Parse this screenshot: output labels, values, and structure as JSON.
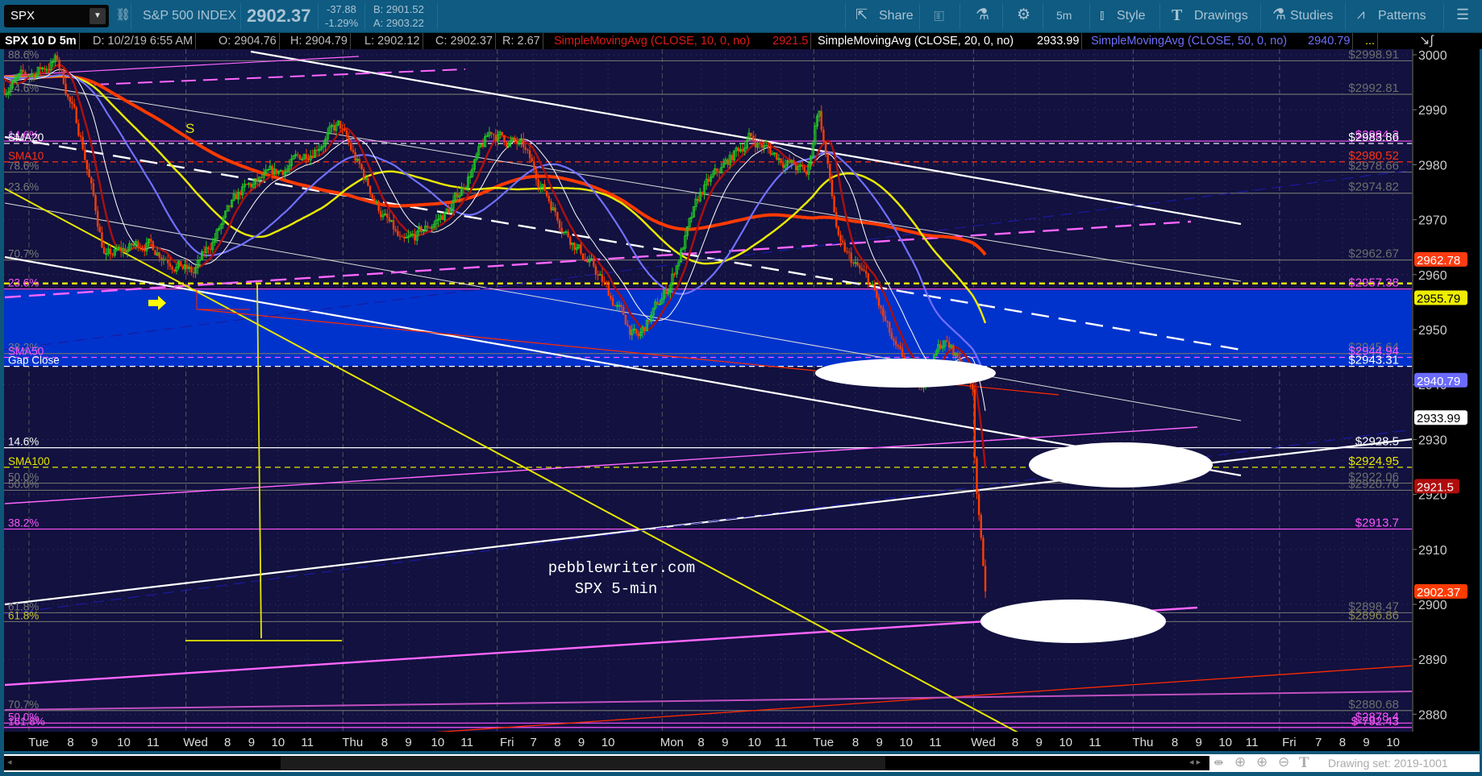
{
  "toolbar": {
    "symbol": "SPX",
    "description": "S&P 500 INDEX",
    "last": "2902.37",
    "change": "-37.88",
    "change_pct": "-1.29%",
    "bid": "B: 2901.52",
    "ask": "A: 2903.22",
    "share": "Share",
    "timeframe": "5m",
    "style": "Style",
    "drawings": "Drawings",
    "studies": "Studies",
    "patterns": "Patterns"
  },
  "infobar": {
    "title": "SPX 10 D 5m",
    "date": "D: 10/2/19 6:55 AM",
    "open": "O: 2904.76",
    "high": "H: 2904.79",
    "low": "L: 2902.12",
    "close": "C: 2902.37",
    "range": "R: 2.67",
    "sma10": "SimpleMovingAvg (CLOSE, 10, 0, no)",
    "sma10_val": "2921.5",
    "sma20": "SimpleMovingAvg (CLOSE, 20, 0, no)",
    "sma20_val": "2933.99",
    "sma50": "SimpleMovingAvg (CLOSE, 50, 0, no)",
    "sma50_val": "2940.79",
    "more": "..."
  },
  "watermark": {
    "line1": "pebblewriter.com",
    "line2": "SPX 5-min"
  },
  "annotation_s": "S",
  "price_axis": {
    "ticks": [
      "3000",
      "2990",
      "2980",
      "2970",
      "2960",
      "2950",
      "2940",
      "2930",
      "2920",
      "2910",
      "2900",
      "2890",
      "2880"
    ],
    "badges": [
      {
        "value": "2962.78",
        "price": 2962.78,
        "bg": "#ff3b12",
        "fg": "#ffffff"
      },
      {
        "value": "2955.79",
        "price": 2955.79,
        "bg": "#eeee00",
        "fg": "#000000"
      },
      {
        "value": "2940.79",
        "price": 2940.79,
        "bg": "#6b6bff",
        "fg": "#ffffff"
      },
      {
        "value": "2933.99",
        "price": 2933.99,
        "bg": "#ffffff",
        "fg": "#000000"
      },
      {
        "value": "2921.5",
        "price": 2921.5,
        "bg": "#b00d0d",
        "fg": "#ffffff"
      },
      {
        "value": "2902.37",
        "price": 2902.37,
        "bg": "#ff3b00",
        "fg": "#ffffff"
      }
    ]
  },
  "time_axis": [
    {
      "label": "Tue",
      "t": 1.3
    },
    {
      "label": "8",
      "t": 2.5
    },
    {
      "label": "9",
      "t": 3.4
    },
    {
      "label": "10",
      "t": 4.5
    },
    {
      "label": "11",
      "t": 5.6
    },
    {
      "label": "Wed",
      "t": 7.2
    },
    {
      "label": "8",
      "t": 8.4
    },
    {
      "label": "9",
      "t": 9.3
    },
    {
      "label": "10",
      "t": 10.3
    },
    {
      "label": "11",
      "t": 11.4
    },
    {
      "label": "Thu",
      "t": 13.1
    },
    {
      "label": "8",
      "t": 14.3
    },
    {
      "label": "9",
      "t": 15.2
    },
    {
      "label": "10",
      "t": 16.3
    },
    {
      "label": "11",
      "t": 17.4
    },
    {
      "label": "Fri",
      "t": 18.9
    },
    {
      "label": "7",
      "t": 19.9
    },
    {
      "label": "8",
      "t": 20.8
    },
    {
      "label": "9",
      "t": 21.7
    },
    {
      "label": "10",
      "t": 22.7
    },
    {
      "label": "Mon",
      "t": 25.1
    },
    {
      "label": "8",
      "t": 26.2
    },
    {
      "label": "9",
      "t": 27.1
    },
    {
      "label": "10",
      "t": 28.2
    },
    {
      "label": "11",
      "t": 29.2
    },
    {
      "label": "Tue",
      "t": 30.8
    },
    {
      "label": "8",
      "t": 32.0
    },
    {
      "label": "9",
      "t": 32.9
    },
    {
      "label": "10",
      "t": 33.9
    },
    {
      "label": "11",
      "t": 35.0
    },
    {
      "label": "Wed",
      "t": 36.8
    },
    {
      "label": "8",
      "t": 38.0
    },
    {
      "label": "9",
      "t": 38.9
    },
    {
      "label": "10",
      "t": 39.9
    },
    {
      "label": "11",
      "t": 41.0
    },
    {
      "label": "Thu",
      "t": 42.8
    },
    {
      "label": "8",
      "t": 44.0
    },
    {
      "label": "9",
      "t": 44.9
    },
    {
      "label": "10",
      "t": 45.9
    },
    {
      "label": "11",
      "t": 46.9
    },
    {
      "label": "Fri",
      "t": 48.3
    },
    {
      "label": "7",
      "t": 49.4
    },
    {
      "label": "8",
      "t": 50.3
    },
    {
      "label": "9",
      "t": 51.2
    },
    {
      "label": "10",
      "t": 52.2
    }
  ],
  "levels": [
    {
      "price": 2998.91,
      "color": "#6e6e6e",
      "dash": false,
      "left": "88.6%",
      "lc": "#7a7a7a",
      "right": "$2998.91",
      "rc": "#6e6e6e"
    },
    {
      "price": 2992.81,
      "color": "#6e6e6e",
      "dash": false,
      "left": "14.6%",
      "lc": "#7a7a7a",
      "right": "$2992.81",
      "rc": "#6e6e6e"
    },
    {
      "price": 2984.3,
      "color": "#ff55ff",
      "dash": false,
      "left": "14.6%",
      "lc": "#ff55ff",
      "right": "$2984.3",
      "rc": "#ff55ff"
    },
    {
      "price": 2983.86,
      "color": "#ffffff",
      "dash": true,
      "left": "SMA20",
      "lc": "#ffffff",
      "right": "$2983.86",
      "rc": "#ffffff"
    },
    {
      "price": 2980.52,
      "color": "#ff3010",
      "dash": true,
      "left": "SMA10",
      "lc": "#ff3010",
      "right": "$2980.52",
      "rc": "#ff3010"
    },
    {
      "price": 2978.66,
      "color": "#6e6e6e",
      "dash": false,
      "left": "78.6%",
      "lc": "#7a7a7a",
      "right": "$2978.66",
      "rc": "#6e6e6e"
    },
    {
      "price": 2974.82,
      "color": "#6e6e6e",
      "dash": false,
      "left": "23.6%",
      "lc": "#7a7a7a",
      "right": "$2974.82",
      "rc": "#6e6e6e"
    },
    {
      "price": 2962.67,
      "color": "#6e6e6e",
      "dash": false,
      "left": "70.7%",
      "lc": "#7a7a7a",
      "right": "$2962.67",
      "rc": "#6e6e6e"
    },
    {
      "price": 2958.4,
      "color": "#e6e600",
      "dash": true,
      "left": "",
      "lc": "#e6e600",
      "right": "",
      "rc": "#e6e600"
    },
    {
      "price": 2957.38,
      "color": "#ff55ff",
      "dash": false,
      "left": "23.6%",
      "lc": "#ff55ff",
      "right": "$2957.38",
      "rc": "#ff55ff"
    },
    {
      "price": 2945.64,
      "color": "#6e6e6e",
      "dash": false,
      "left": "38.2%",
      "lc": "#7a7a7a",
      "right": "$2945.64",
      "rc": "#6e6e6e"
    },
    {
      "price": 2944.94,
      "color": "#ff55ff",
      "dash": true,
      "left": "SMA50",
      "lc": "#ff55ff",
      "right": "$2944.94",
      "rc": "#ff55ff"
    },
    {
      "price": 2943.31,
      "color": "#ffffff",
      "dash": true,
      "left": "Gap Close",
      "lc": "#ffffff",
      "right": "$2943.31",
      "rc": "#ffffff"
    },
    {
      "price": 2928.5,
      "color": "#ffffff",
      "dash": false,
      "left": "14.6%",
      "lc": "#ffffff",
      "right": "$2928.5",
      "rc": "#ffffff"
    },
    {
      "price": 2924.95,
      "color": "#e6e600",
      "dash": true,
      "left": "SMA100",
      "lc": "#e6e600",
      "right": "$2924.95",
      "rc": "#e6e600"
    },
    {
      "price": 2922.06,
      "color": "#6e6e6e",
      "dash": false,
      "left": "50.0%",
      "lc": "#7a7a7a",
      "right": "$2922.06",
      "rc": "#6e6e6e"
    },
    {
      "price": 2920.76,
      "color": "#6e6e6e",
      "dash": false,
      "left": "50.0%",
      "lc": "#7a7a7a",
      "right": "$2920.76",
      "rc": "#6e6e6e"
    },
    {
      "price": 2913.7,
      "color": "#ff55ff",
      "dash": false,
      "left": "38.2%",
      "lc": "#ff55ff",
      "right": "$2913.7",
      "rc": "#ff55ff"
    },
    {
      "price": 2898.47,
      "color": "#6e6e6e",
      "dash": false,
      "left": "61.8%",
      "lc": "#7a7a7a",
      "right": "$2898.47",
      "rc": "#6e6e6e"
    },
    {
      "price": 2896.86,
      "color": "#6e6e6e",
      "dash": false,
      "left": "61.8%",
      "lc": "#c8c832",
      "right": "$2896.86",
      "rc": "#8a8a50"
    },
    {
      "price": 2880.68,
      "color": "#6e6e6e",
      "dash": false,
      "left": "70.7%",
      "lc": "#7a7a7a",
      "right": "$2880.68",
      "rc": "#6e6e6e"
    },
    {
      "price": 2878.4,
      "color": "#ff55ff",
      "dash": false,
      "left": "50.0%",
      "lc": "#ff55ff",
      "right": "$2878.4",
      "rc": "#ff55ff"
    },
    {
      "price": 2877.6,
      "color": "#ff55ff",
      "dash": false,
      "left": "161.8%",
      "lc": "#ff55ff",
      "right": "$-792.43",
      "rc": "#ff55ff"
    }
  ],
  "gap_zone": {
    "top": 2957.2,
    "bottom": 2943.31,
    "color": "#0033cc"
  },
  "price_path": [
    [
      0,
      2994
    ],
    [
      2,
      2999
    ],
    [
      2.9,
      2985
    ],
    [
      3.8,
      2963
    ],
    [
      5.3,
      2966
    ],
    [
      7.1,
      2960
    ],
    [
      8.9,
      2975
    ],
    [
      10.8,
      2980
    ],
    [
      12.6,
      2987
    ],
    [
      14.1,
      2972
    ],
    [
      15,
      2965
    ],
    [
      16.8,
      2972
    ],
    [
      18.3,
      2986
    ],
    [
      19.5,
      2983
    ],
    [
      21.1,
      2968
    ],
    [
      22.3,
      2960
    ],
    [
      23.8,
      2948
    ],
    [
      25,
      2958
    ],
    [
      26.2,
      2975
    ],
    [
      28,
      2985
    ],
    [
      30.2,
      2978
    ],
    [
      30.6,
      2991
    ],
    [
      31,
      2978
    ],
    [
      31.4,
      2965
    ],
    [
      32.6,
      2958
    ],
    [
      33.5,
      2946
    ],
    [
      34.4,
      2940
    ],
    [
      35.3,
      2948
    ],
    [
      36,
      2944
    ],
    [
      36.4,
      2940
    ],
    [
      36.5,
      2925
    ],
    [
      36.7,
      2912
    ],
    [
      36.9,
      2902.4
    ]
  ],
  "studies": [
    {
      "name": "sma10",
      "period": 10,
      "color": "#a81010",
      "width": 2.5
    },
    {
      "name": "sma20",
      "period": 20,
      "color": "#ffffff",
      "width": 1
    },
    {
      "name": "sma50",
      "period": 50,
      "color": "#7070ff",
      "width": 2.2
    },
    {
      "name": "long-avg-yellow",
      "period": 80,
      "color": "#e8e800",
      "width": 2.5
    },
    {
      "name": "long-avg-orange",
      "period": 140,
      "color": "#ff3a00",
      "width": 4
    }
  ],
  "footer": {
    "drawing_set": "Drawing set: 2019-1001"
  }
}
